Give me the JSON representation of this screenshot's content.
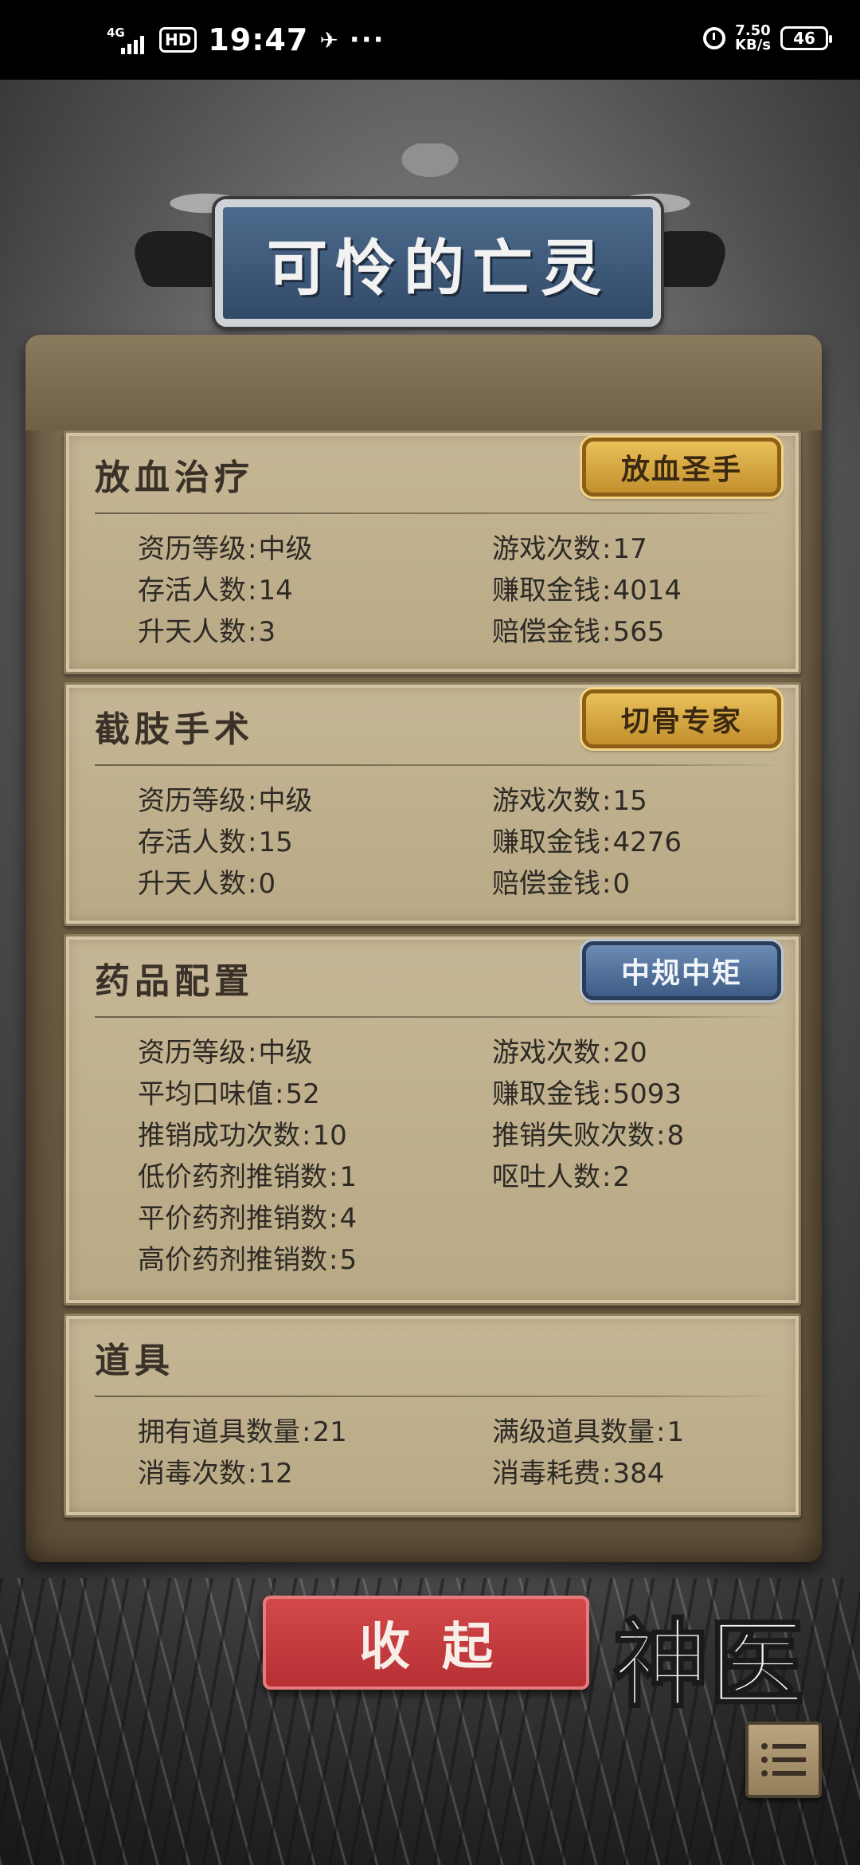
{
  "status_bar": {
    "network": "4G",
    "hd": "HD",
    "time": "19:47",
    "dots": "···",
    "speed_value": "7.50",
    "speed_unit": "KB/s",
    "battery": "46"
  },
  "title": "可怜的亡灵",
  "sections": [
    {
      "title": "放血治疗",
      "badge": "放血圣手",
      "badge_style": "gold",
      "stats_left": [
        {
          "label": "资历等级",
          "value": "中级"
        },
        {
          "label": "存活人数",
          "value": "14"
        },
        {
          "label": "升天人数",
          "value": "3"
        }
      ],
      "stats_right": [
        {
          "label": "游戏次数",
          "value": "17"
        },
        {
          "label": "赚取金钱",
          "value": "4014"
        },
        {
          "label": "赔偿金钱",
          "value": "565"
        }
      ]
    },
    {
      "title": "截肢手术",
      "badge": "切骨专家",
      "badge_style": "gold",
      "stats_left": [
        {
          "label": "资历等级",
          "value": "中级"
        },
        {
          "label": "存活人数",
          "value": "15"
        },
        {
          "label": "升天人数",
          "value": "0"
        }
      ],
      "stats_right": [
        {
          "label": "游戏次数",
          "value": "15"
        },
        {
          "label": "赚取金钱",
          "value": "4276"
        },
        {
          "label": "赔偿金钱",
          "value": "0"
        }
      ]
    },
    {
      "title": "药品配置",
      "badge": "中规中矩",
      "badge_style": "blue",
      "stats_left": [
        {
          "label": "资历等级",
          "value": "中级"
        },
        {
          "label": "平均口味值",
          "value": "52"
        },
        {
          "label": "推销成功次数",
          "value": "10"
        },
        {
          "label": "低价药剂推销数",
          "value": "1"
        },
        {
          "label": "平价药剂推销数",
          "value": "4"
        },
        {
          "label": "高价药剂推销数",
          "value": "5"
        }
      ],
      "stats_right": [
        {
          "label": "游戏次数",
          "value": "20"
        },
        {
          "label": "赚取金钱",
          "value": "5093"
        },
        {
          "label": "推销失败次数",
          "value": "8"
        },
        {
          "label": "呕吐人数",
          "value": "2"
        }
      ]
    },
    {
      "title": "道具",
      "stats_left": [
        {
          "label": "拥有道具数量",
          "value": "21"
        },
        {
          "label": "消毒次数",
          "value": "12"
        }
      ],
      "stats_right": [
        {
          "label": "满级道具数量",
          "value": "1"
        },
        {
          "label": "消毒耗费",
          "value": "384"
        }
      ]
    }
  ],
  "collapse_button": "收起",
  "logo_text": "神医",
  "colors": {
    "gold_badge": "#d4a23f",
    "blue_badge": "#5577a0",
    "collapse_red": "#c23b3d",
    "parchment": "#c0b08e"
  }
}
